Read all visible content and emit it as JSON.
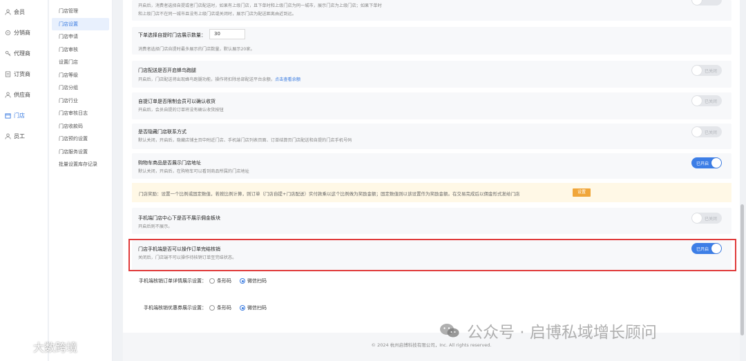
{
  "nav_primary": [
    {
      "label": "会员",
      "icon": "user-icon",
      "active": false
    },
    {
      "label": "分销商",
      "icon": "distributor-icon",
      "active": false
    },
    {
      "label": "代理商",
      "icon": "agent-icon",
      "active": false
    },
    {
      "label": "订货商",
      "icon": "order-icon",
      "active": false
    },
    {
      "label": "供应商",
      "icon": "supplier-icon",
      "active": false
    },
    {
      "label": "门店",
      "icon": "store-icon",
      "active": true
    },
    {
      "label": "员工",
      "icon": "staff-icon",
      "active": false
    }
  ],
  "nav_secondary": [
    {
      "label": "门店管理",
      "active": false
    },
    {
      "label": "门店设置",
      "active": true
    },
    {
      "label": "门店申请",
      "active": false
    },
    {
      "label": "门店审核",
      "active": false
    },
    {
      "label": "设置门店",
      "active": false
    },
    {
      "label": "门店等级",
      "active": false
    },
    {
      "label": "门店分组",
      "active": false
    },
    {
      "label": "门店行业",
      "active": false
    },
    {
      "label": "门店审核日志",
      "active": false
    },
    {
      "label": "门店收款码",
      "active": false
    },
    {
      "label": "门店预约设置",
      "active": false
    },
    {
      "label": "门店服务设置",
      "active": false
    },
    {
      "label": "批量设置库存记录",
      "active": false
    }
  ],
  "cards": {
    "top_desc_1": "开启后，消费者选择自提或者门店配送时，如果有上级门店，且下单时和上级门店为同一城市，展示门店为上级门店；如果下单时",
    "top_desc_2": "和上级门店不在同一城市且没有上级门店或关闭时，展示门店为配送距离由近到远。",
    "pickup_count_label": "下单选择自提时门店展示数量：",
    "pickup_count_value": "30",
    "pickup_count_desc": "消费者选择门店自提时最多展示的门店数量，默认展示20家。",
    "fengniao_title": "门店配送是否开启蜂鸟跑腿",
    "fengniao_desc": "开启后，门店配送将出现蜂鸟跑腿功能，操作将扣除总部配送平台余额，",
    "fengniao_link": "点击查看余额",
    "confirm_title": "自提订单是否限制会员可以确认收货",
    "confirm_desc": "开启后，会员自提的订单将没有确认收货按钮",
    "hide_contact_title": "是否隐藏门店联系方式",
    "hide_contact_desc": "默认关闭，开启后，隐藏店铺主页中附近门店、手机端门店列表页面、订单结算页门店配送和自提的门店手机号码",
    "cart_address_title": "购物车商品是否展示门店地址",
    "cart_address_desc": "默认关闭，开启后，在购物车可以看到商品所属的门店地址",
    "reward_notice": "门店奖励：设置一个比例或固定数值，若按比例计算，则订单（门店自提+门店配送）实付款乘以这个比例做为奖励金额；固定数值则以该设置作为奖励金额。在交易完成后以佣金形式发给门店",
    "reward_btn": "设置",
    "commission_title": "手机端门店中心下是否不展示佣金板块",
    "commission_desc": "开启后则不展示。",
    "complete_title": "门店手机端是否可以操作订单完结核销",
    "complete_desc": "关闭后，门店端不可以操作待核销订单至完结状态。"
  },
  "toggles": {
    "off_label": "已关闭",
    "on_label": "已开启"
  },
  "radio_order": {
    "label": "手机端核销订单详情展示设置：",
    "option1": "条形码",
    "option2": "微信扫码",
    "selected": "微信扫码"
  },
  "radio_coupon": {
    "label": "手机端核销优惠券展示设置：",
    "option1": "条形码",
    "option2": "微信扫码",
    "selected": "微信扫码"
  },
  "footer": {
    "copyright": "© 2024 杭州启博科技有限公司，Inc. All rights reserved."
  },
  "watermarks": {
    "left": "大数跨境",
    "right": "公众号 · 启博私域增长顾问"
  },
  "colors": {
    "accent": "#3d7ee6",
    "highlight_border": "#e03a3a",
    "notice_bg": "#fff8e6",
    "notice_button": "#f0a63a"
  }
}
